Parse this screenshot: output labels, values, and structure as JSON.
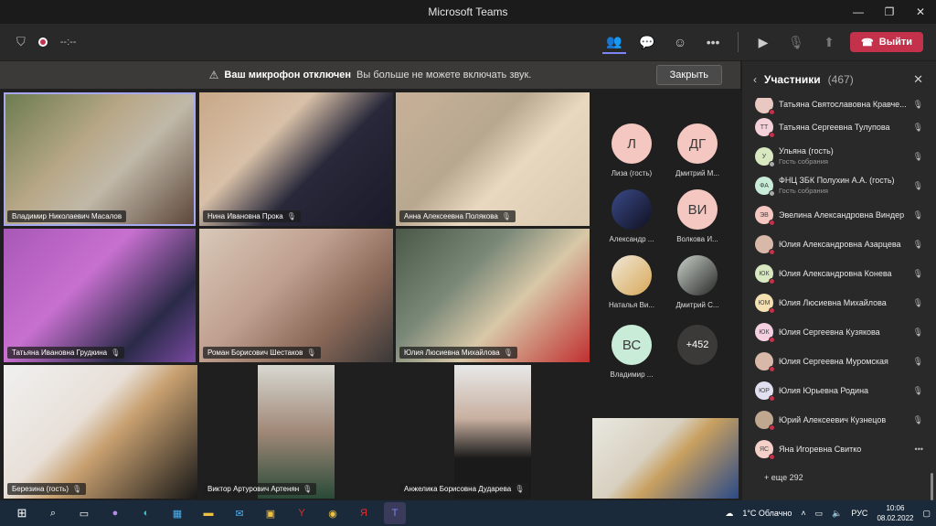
{
  "window": {
    "title": "Microsoft Teams"
  },
  "toolbar": {
    "timer": "--:--",
    "leave_label": "Выйти"
  },
  "banner": {
    "bold": "Ваш микрофон отключен",
    "text": "Вы больше не можете включать звук.",
    "close_label": "Закрыть"
  },
  "tiles": [
    {
      "name": "Владимир Николаевич Масалов"
    },
    {
      "name": "Нина Ивановна Прока"
    },
    {
      "name": "Анна Алексеевна Полякова"
    },
    {
      "name": "Татьяна Ивановна Грудкина"
    },
    {
      "name": "Роман Борисович Шестаков"
    },
    {
      "name": "Юлия Люсиевна Михайлова"
    },
    {
      "name": "Березина (гость)"
    },
    {
      "name": "Виктор Артурович Артенян"
    },
    {
      "name": "Анжелика Борисовна Дударева"
    }
  ],
  "avatars": [
    {
      "initials": "Л",
      "label": "Лиза (гость)",
      "color": "#f4c7c0"
    },
    {
      "initials": "ДГ",
      "label": "Дмитрий М...",
      "color": "#f4c7c0"
    },
    {
      "initials": "",
      "label": "Александр ...",
      "color": "#223"
    },
    {
      "initials": "ВИ",
      "label": "Волкова И...",
      "color": "#f4c7c0"
    },
    {
      "initials": "",
      "label": "Наталья Ви...",
      "color": "#dbe4ee"
    },
    {
      "initials": "",
      "label": "Дмитрий С...",
      "color": "#bcc"
    },
    {
      "initials": "ВС",
      "label": "Владимир ...",
      "color": "#c9ecd9"
    },
    {
      "initials": "+452",
      "label": "",
      "color": "#3b3a39"
    }
  ],
  "panel": {
    "title": "Участники",
    "count": "(467)",
    "more_label": "+ еще 292"
  },
  "participants": [
    {
      "initials": "",
      "name": "Татьяна Святославовна Кравче...",
      "sub": "",
      "color": "#e8c8c0"
    },
    {
      "initials": "ТТ",
      "name": "Татьяна Сергеевна Тулупова",
      "sub": "",
      "color": "#f4d0d8"
    },
    {
      "initials": "У",
      "name": "Ульяна (гость)",
      "sub": "Гость собрания",
      "color": "#d8e8c0"
    },
    {
      "initials": "ФА",
      "name": "ФНЦ ЗБК Полухин А.А. (гость)",
      "sub": "Гость собрания",
      "color": "#c8ecd8"
    },
    {
      "initials": "ЭВ",
      "name": "Эвелина Александровна Виндер",
      "sub": "",
      "color": "#f4c7c0"
    },
    {
      "initials": "",
      "name": "Юлия Александровна Азарцева",
      "sub": "",
      "color": "#d8b8a8"
    },
    {
      "initials": "ЮК",
      "name": "Юлия Александровна Конева",
      "sub": "",
      "color": "#d8e8c0"
    },
    {
      "initials": "ЮМ",
      "name": "Юлия Люсиевна Михайлова",
      "sub": "",
      "color": "#f4e0b0"
    },
    {
      "initials": "ЮК",
      "name": "Юлия Сергеевна Кузякова",
      "sub": "",
      "color": "#f4d0e0"
    },
    {
      "initials": "",
      "name": "Юлия Сергеевна Муромская",
      "sub": "",
      "color": "#d8b8a8"
    },
    {
      "initials": "ЮР",
      "name": "Юлия Юрьевна Родина",
      "sub": "",
      "color": "#e0e0f0"
    },
    {
      "initials": "",
      "name": "Юрий Алексеевич Кузнецов",
      "sub": "",
      "color": "#c0a890"
    },
    {
      "initials": "ЯС",
      "name": "Яна Игоревна Свитко",
      "sub": "",
      "color": "#f4d0c8"
    }
  ],
  "taskbar": {
    "weather": "1°C  Облачно",
    "lang": "РУС",
    "time": "10:06",
    "date": "08.02.2022"
  }
}
